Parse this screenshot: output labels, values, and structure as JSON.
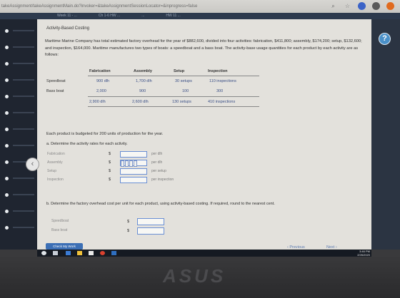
{
  "browser": {
    "url": "takeAssignment/takeAssignmentMain.do?invoker=&takeAssignmentSessionLocator=&inprogress=false",
    "tabs": [
      "Week 11 - ...",
      "Ch 1-6 HW ...",
      "...",
      "HW 11 ..."
    ]
  },
  "assignment": {
    "title": "Activity-Based Costing",
    "intro": "Maritime Marine Company has total estimated factory overhead for the year of $882,600, divided into four activities: fabrication, $411,800; assembly, $174,200; setup, $132,600; and inspection, $164,000. Maritime manufactures two types of boats: a speedboat and a bass boat. The activity-base usage quantities for each product by each activity are as follows:",
    "table": {
      "headers": [
        "",
        "Fabrication",
        "Assembly",
        "Setup",
        "Inspection"
      ],
      "rows": [
        [
          "Speedboat",
          "900 dlh",
          "1,700 dlh",
          "30 setups",
          "110 inspections"
        ],
        [
          "Bass boat",
          "2,000",
          "900",
          "100",
          "300"
        ],
        [
          "",
          "2,900 dlh",
          "2,600 dlh",
          "130 setups",
          "410 inspections"
        ]
      ]
    },
    "note": "Each product is budgeted for 200 units of production for the year.",
    "part_a": {
      "prompt": "a. Determine the activity rates for each activity.",
      "rows": [
        {
          "label": "Fabrication",
          "currency": "$",
          "unit": "per dlh"
        },
        {
          "label": "Assembly",
          "currency": "$",
          "unit": "per dlh"
        },
        {
          "label": "Setup",
          "currency": "$",
          "unit": "per setup"
        },
        {
          "label": "Inspection",
          "currency": "$",
          "unit": "per inspection"
        }
      ]
    },
    "part_b": {
      "prompt": "b. Determine the factory overhead cost per unit for each product, using activity-based costing. If required, round to the nearest cent.",
      "rows": [
        {
          "label": "Speedboat",
          "currency": "$"
        },
        {
          "label": "Bass boat",
          "currency": "$"
        }
      ]
    },
    "buttons": {
      "check": "Check My Work",
      "previous": "Previous",
      "next": "Next"
    },
    "help_glyph": "?"
  },
  "taskbar": {
    "time": "3:46 PM",
    "date": "2/26/2020"
  },
  "device": {
    "brand": "ASUS"
  },
  "colors": {
    "accent": "#3c6fb5",
    "sidebar": "#1f2530",
    "panel": "#e3e1dc"
  }
}
